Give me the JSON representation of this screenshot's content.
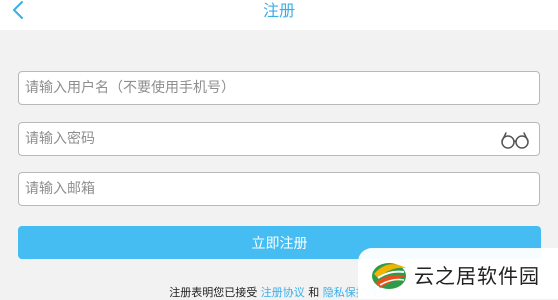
{
  "header": {
    "title": "注册",
    "back_icon": "chevron-left-icon"
  },
  "form": {
    "username_placeholder": "请输入用户名（不要使用手机号）",
    "password_placeholder": "请输入密码",
    "email_placeholder": "请输入邮箱",
    "password_toggle_icon": "glasses-icon",
    "submit_label": "立即注册"
  },
  "agreement": {
    "prefix": "注册表明您已接受",
    "terms_link": "注册协议",
    "conjunction": "和",
    "privacy_link": "隐私保护政策"
  },
  "watermark": {
    "text": "云之居软件园"
  },
  "colors": {
    "accent": "#3aaee9",
    "button": "#45bdf2",
    "background": "#f2f2f2",
    "border": "#b9b9b9"
  }
}
